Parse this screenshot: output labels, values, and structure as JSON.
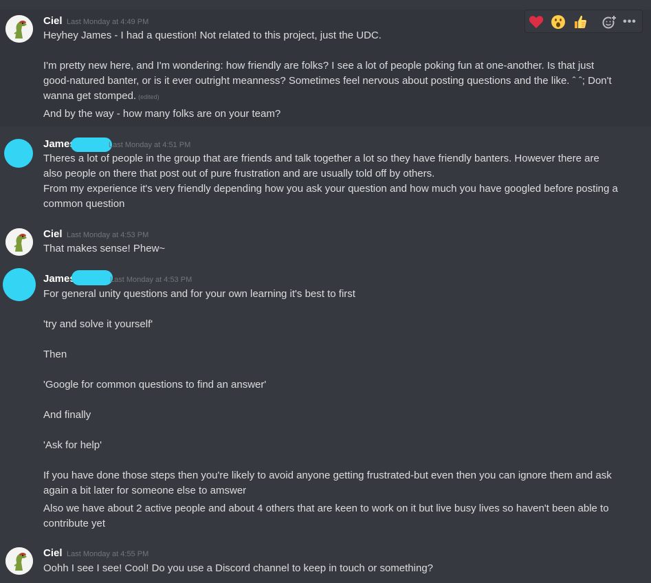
{
  "toolbar": {
    "reactions": [
      {
        "icon": "heart-icon",
        "glyph": "❤"
      },
      {
        "icon": "open-mouth-face-icon",
        "glyph": "😮"
      },
      {
        "icon": "thumbs-up-icon",
        "glyph": "👍"
      }
    ],
    "add_reaction_icon": "add-reaction-icon",
    "more_label": "•••"
  },
  "messages": [
    {
      "author": "Ciel",
      "timestamp": "Last Monday at 4:49 PM",
      "lines": [
        "Heyhey James - I had a question! Not related to this project, just the UDC.",
        "",
        "I'm pretty new here, and I'm wondering: how friendly are folks? I see a lot of people poking fun at one-another. Is that just",
        "good-natured banter, or is it ever outright meanness? Sometimes feel nervous about posting questions and the like. ˆ ˆ; Don't",
        "wanna get stomped."
      ],
      "edited_label": "(edited)",
      "followup": "And by the way - how many folks are on your team?"
    },
    {
      "author": "James",
      "timestamp": "Last Monday at 4:51 PM",
      "lines": [
        "Theres a lot of people in the group that are friends and talk together a lot so they have friendly banters. However there are",
        "also people on there that post out of pure frustration and are usually told off by others.",
        "From my experience it's very friendly depending how you ask your question and how much you have googled before posting a",
        "common question"
      ]
    },
    {
      "author": "Ciel",
      "timestamp": "Last Monday at 4:53 PM",
      "lines": [
        "That makes sense! Phew~"
      ]
    },
    {
      "author": "James",
      "timestamp": "Last Monday at 4:53 PM",
      "lines": [
        "For general unity questions and for your own learning it's best to first",
        "",
        " 'try and solve it yourself'",
        "",
        "Then",
        "",
        "'Google for common questions to find an answer'",
        "",
        "And finally",
        "",
        "'Ask for help'",
        "",
        "If you have done those steps then you're likely to avoid anyone getting frustrated-but even then you can ignore them and ask",
        "again a bit later for someone else to amswer"
      ],
      "followup_lines": [
        "Also we have about 2 active people and about 4 others that are keen to work on it but live busy lives so haven't been able to",
        "contribute yet"
      ]
    },
    {
      "author": "Ciel",
      "timestamp": "Last Monday at 4:55 PM",
      "lines": [
        "Oohh I see I see! Cool! Do you use a Discord channel to keep in touch or something?"
      ]
    }
  ]
}
